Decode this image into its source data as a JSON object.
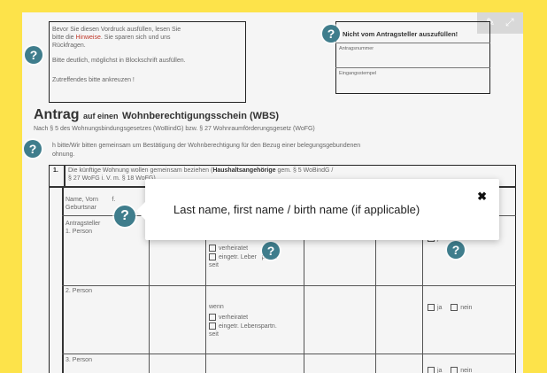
{
  "top": {
    "intro_line1": "Bevor Sie diesen Vordruck ausfüllen, lesen Sie",
    "intro_line2_a": "bitte die",
    "intro_line2_hl": "Hinweise",
    "intro_line2_b": ". Sie sparen sich und uns",
    "intro_line3": "Rückfragen.",
    "intro_line4": "Bitte deutlich, möglichst in Blockschrift ausfüllen.",
    "intro_line5": "Zutreffendes bitte ankreuzen !",
    "official_header": "Nicht vom Antragsteller auszufüllen!",
    "official_field1": "Antragsnummer",
    "official_field2": "Eingangsstempel"
  },
  "heading": {
    "antrag": "Antrag",
    "auf_einen": "auf einen",
    "wbs": "Wohnberechtigungsschein (WBS)",
    "subtitle": "Nach § 5 des Wohnungsbindungsgesetzes (WoBindG) bzw. § 27 Wohnraumförderungsgesetz (WoFG)",
    "request1": "h bitte/Wir bitten gemeinsam um Bestätigung der Wohnberechtigung für den Bezug einer belegungsgebundenen",
    "request2": "ohnung."
  },
  "section1": {
    "number": "1.",
    "text1_a": "Die künftige Wohnung wollen gemeinsam beziehen (",
    "text1_b": "Haushaltsangehörige",
    "text1_c": " gem. § 5 WoBindG /",
    "text2": "§ 27 WoFG i. V. m. § 18 WoFG)",
    "col_name1": "Name, Vorn",
    "col_name1_b": "f.",
    "col_name2": "Geburtsnar",
    "col_geb": "Ge",
    "antragsteller": "Antragsteller",
    "person1": "1. Person",
    "person2": "2. Person",
    "person3": "3. Person",
    "wenn": "wenn",
    "verheiratet": "verheiratet",
    "eingetr1": "eingetr. Leber",
    "eingetr1_b": "partn.",
    "seit": "seit",
    "eingetr_full": "eingetr. Lebenspartn.",
    "ja": "ja",
    "nein": "nein"
  },
  "tooltip": {
    "text": "Last name, first name / birth name (if applicable)",
    "close": "✖"
  },
  "help_glyph": "?",
  "toolbar_icons": [
    "pencil-icon",
    "fullscreen-icon"
  ]
}
